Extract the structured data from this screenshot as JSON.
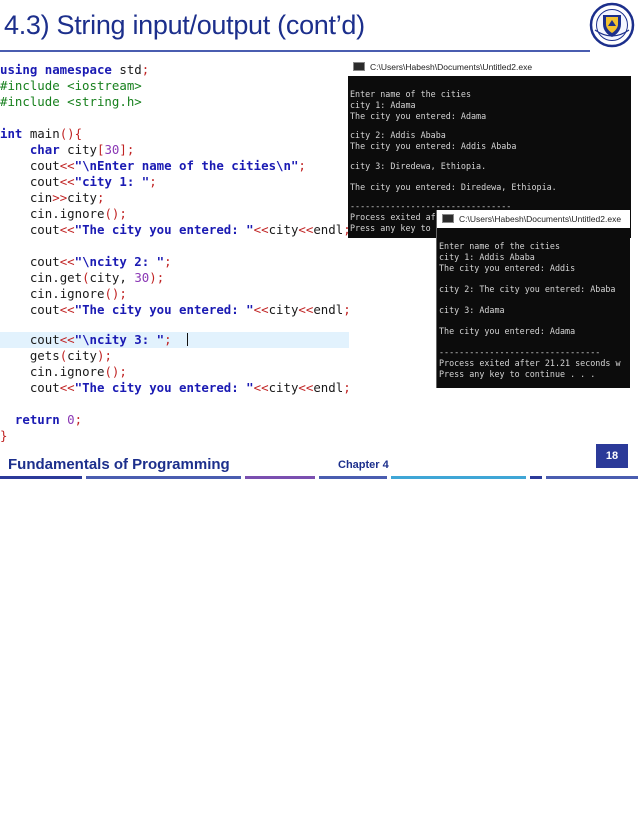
{
  "slide": {
    "title": "4.3) String input/output (cont’d)",
    "footer_left": "Fundamentals of Programming",
    "footer_mid": "Chapter 4",
    "page_number": "18",
    "logo_icon": "university-seal-icon"
  },
  "colors": {
    "title": "#1c2f8c",
    "keyword": "#1a1ab3",
    "preprocessor": "#17801d",
    "operator": "#c02323",
    "number": "#8a38b5",
    "highlight_line": "#e2f2fd",
    "console_bg": "#0c0c0c"
  },
  "code": {
    "l1_kw": "using namespace",
    "l1_rest": " std",
    "semi": ";",
    "l2": "#include <iostream>",
    "l3": "#include <string.h>",
    "l5_kw": "int",
    "l5_name": " main",
    "l5_paren": "(){",
    "l6_kw": "char",
    "l6_var": " city",
    "l6_lb": "[",
    "l6_num": "30",
    "l6_rb": "];",
    "cout": "cout",
    "cin": "cin",
    "shl": "<<",
    "shr": ">>",
    "l7_str": "\"\\nEnter name of the cities\\n\"",
    "l8_str": "\"city 1: \"",
    "l9_var": "city",
    "l10_ignore": ".ignore",
    "parens_semi": "();",
    "l11_str": "\"The city you entered: \"",
    "city": "city",
    "endl": "endl",
    "l13_str": "\"\\ncity 2: \"",
    "l14_get": ".get",
    "lp": "(",
    "l14_args": "city, ",
    "l14_num": "30",
    "rp_semi": ");",
    "l18_str": "\"\\ncity 3: \"",
    "l19_gets": "gets",
    "l19_arg": "city",
    "return_kw": "return",
    "return_num": " 0",
    "close_brace": "}"
  },
  "console1": {
    "title": "C:\\Users\\Habesh\\Documents\\Untitled2.exe",
    "lines": [
      "Enter name of the cities",
      "city 1: Adama",
      "The city you entered: Adama",
      "city 2: Addis Ababa",
      "The city you entered: Addis Ababa",
      "city 3: Diredewa, Ethiopia.",
      "The city you entered: Diredewa, Ethiopia.",
      "--------------------------------",
      "Process exited af",
      "Press any key to"
    ]
  },
  "console2": {
    "title": "C:\\Users\\Habesh\\Documents\\Untitled2.exe",
    "lines": [
      "Enter name of the cities",
      "city 1: Addis Ababa",
      "The city you entered: Addis",
      "city 2: The city you entered: Ababa",
      "city 3: Adama",
      "The city you entered: Adama",
      "--------------------------------",
      "Process exited after 21.21 seconds w",
      "Press any key to continue . . ."
    ]
  }
}
